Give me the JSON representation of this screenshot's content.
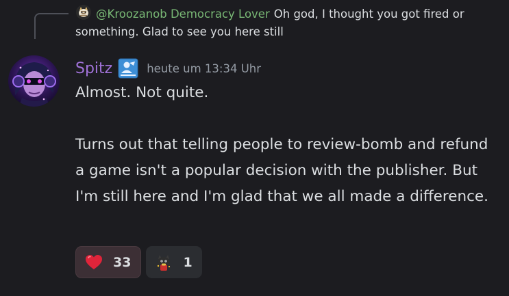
{
  "reply": {
    "author": "@Kroozanob Democracy Lover",
    "text": "Oh god, I thought you got fired or something.  Glad to see you here still",
    "avatar_icon": "tiger-mascot-avatar"
  },
  "message": {
    "author": "Spitz",
    "author_color": "#a072d8",
    "role_icon": "role-badge-icon",
    "timestamp": "heute um 13:34 Uhr",
    "paragraphs": [
      "Almost. Not quite.",
      "Turns out that telling people to review-bomb and refund a game isn't a popular decision with the publisher. But I'm still here and I'm glad that we all made a difference."
    ]
  },
  "reactions": [
    {
      "emoji": "heart-icon",
      "count": "33",
      "reacted": true
    },
    {
      "emoji": "cat-with-bag-emoji-icon",
      "count": "1",
      "reacted": false
    }
  ]
}
